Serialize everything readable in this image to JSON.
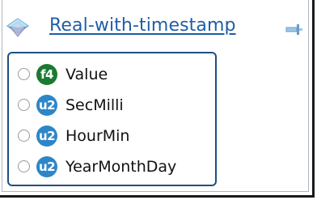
{
  "node": {
    "title": "Real-with-timestamp",
    "icon": "diamond-struct-icon",
    "pin_icon": "pin-icon"
  },
  "fields": [
    {
      "type": "f4",
      "label": "Value"
    },
    {
      "type": "u2",
      "label": "SecMilli"
    },
    {
      "type": "u2",
      "label": "HourMin"
    },
    {
      "type": "u2",
      "label": "YearMonthDay"
    }
  ],
  "colors": {
    "title_link": "#1f5ea8",
    "float_badge": "#1b7a30",
    "uint_badge": "#2d86c8",
    "fields_border": "#1e4f80"
  }
}
